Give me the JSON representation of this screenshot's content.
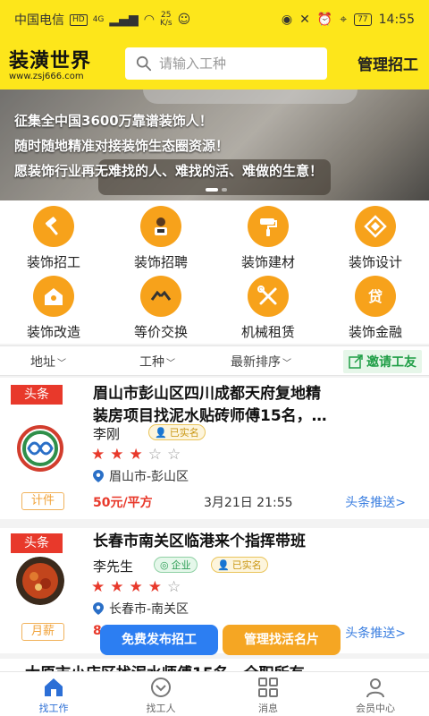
{
  "status_bar": {
    "carrier": "中国电信",
    "hd": "HD",
    "net": "4G",
    "speed": "25",
    "speed_unit": "K/s",
    "battery": "77",
    "time": "14:55"
  },
  "header": {
    "logo_title": "装潢世界",
    "logo_url": "www.zsj666.com",
    "search_placeholder": "请输入工种",
    "manage_label": "管理招工",
    "bg_color": "#fde61b"
  },
  "banner": {
    "lines": [
      "征集全中国3600万靠谱装饰人！",
      "随时随地精准对接装饰生态圈资源！",
      "愿装饰行业再无难找的人、难找的活、难做的生意！"
    ]
  },
  "categories": [
    {
      "label": "装饰招工",
      "icon": "hammer-icon"
    },
    {
      "label": "装饰招聘",
      "icon": "recruit-icon"
    },
    {
      "label": "装饰建材",
      "icon": "paint-roller-icon"
    },
    {
      "label": "装饰设计",
      "icon": "design-icon"
    },
    {
      "label": "装饰改造",
      "icon": "home-renovate-icon"
    },
    {
      "label": "等价交换",
      "icon": "exchange-icon"
    },
    {
      "label": "机械租赁",
      "icon": "tools-icon"
    },
    {
      "label": "装饰金融",
      "icon": "loan-icon"
    }
  ],
  "filters": {
    "address": "地址",
    "trade": "工种",
    "sort": "最新排序",
    "invite": "邀请工友"
  },
  "listings": [
    {
      "tag": "头条",
      "title_line1": "眉山市彭山区四川成都天府复地精",
      "title_line2": "装房项目找泥水贴砖师傅15名，…",
      "name": "李刚",
      "verified": "已实名",
      "rating": 3,
      "location": "眉山市-彭山区",
      "pay_type": "计件",
      "price": "50元/平方",
      "date": "3月21日 21:55",
      "push": "头条推送>"
    },
    {
      "tag": "头条",
      "title_line1": "长春市南关区临港来个指挥带班",
      "name": "李先生",
      "company": "企业",
      "verified": "已实名",
      "rating": 4,
      "location": "长春市-南关区",
      "pay_type": "月薪",
      "price": "8",
      "push": "头条推送>"
    }
  ],
  "peek_title": "太原市小店区找泥水师傅15名，全职所有",
  "fab": {
    "post": "免费发布招工",
    "card": "管理找活名片"
  },
  "bottom_nav": [
    {
      "label": "找工作",
      "icon": "home-icon",
      "active": true
    },
    {
      "label": "找工人",
      "icon": "workers-icon",
      "active": false
    },
    {
      "label": "消息",
      "icon": "messages-icon",
      "active": false
    },
    {
      "label": "会员中心",
      "icon": "user-icon",
      "active": false
    }
  ],
  "colors": {
    "accent_yellow": "#fde61b",
    "icon_orange": "#f7a21b",
    "tag_red": "#e8392b",
    "link_blue": "#3a7ee0"
  }
}
